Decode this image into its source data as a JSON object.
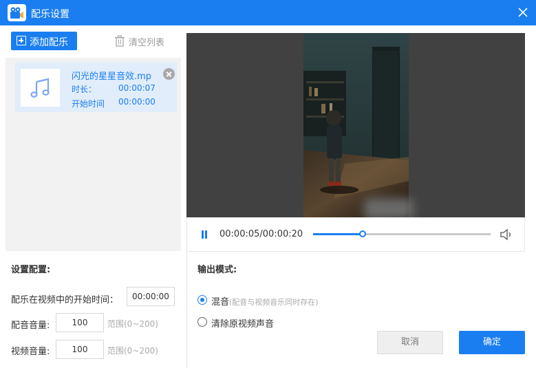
{
  "window": {
    "title": "配乐设置",
    "app_icon": "film-camera-icon",
    "close_icon": "close-icon",
    "accent_color": "#1a7ef0"
  },
  "music_list": {
    "add_label": "添加配乐",
    "clear_label": "清空列表",
    "items": [
      {
        "name": "闪光的星星音效.mp",
        "duration_label": "时长：",
        "duration": "00:00:07",
        "start_label": "开始时间",
        "start": "00:00:00",
        "icon": "music-note-icon"
      }
    ]
  },
  "settings": {
    "title": "设置配置:",
    "start_time_label": "配乐在视频中的开始时间：",
    "start_time_value": "00:00:00",
    "music_volume_label": "配音音量:",
    "music_volume_value": "100",
    "music_volume_range": "范围(0~200)",
    "video_volume_label": "视频音量:",
    "video_volume_value": "100",
    "video_volume_range": "范围(0~200)"
  },
  "player": {
    "time_display": "00:00:05/00:00:20",
    "progress_fraction": 0.28,
    "state": "playing"
  },
  "output": {
    "title": "输出模式:",
    "options": [
      {
        "label": "混音",
        "hint": "(配音与视频音乐同时存在)",
        "selected": true
      },
      {
        "label": "清除原视频声音",
        "hint": "",
        "selected": false
      }
    ]
  },
  "buttons": {
    "cancel": "取消",
    "ok": "确定"
  }
}
